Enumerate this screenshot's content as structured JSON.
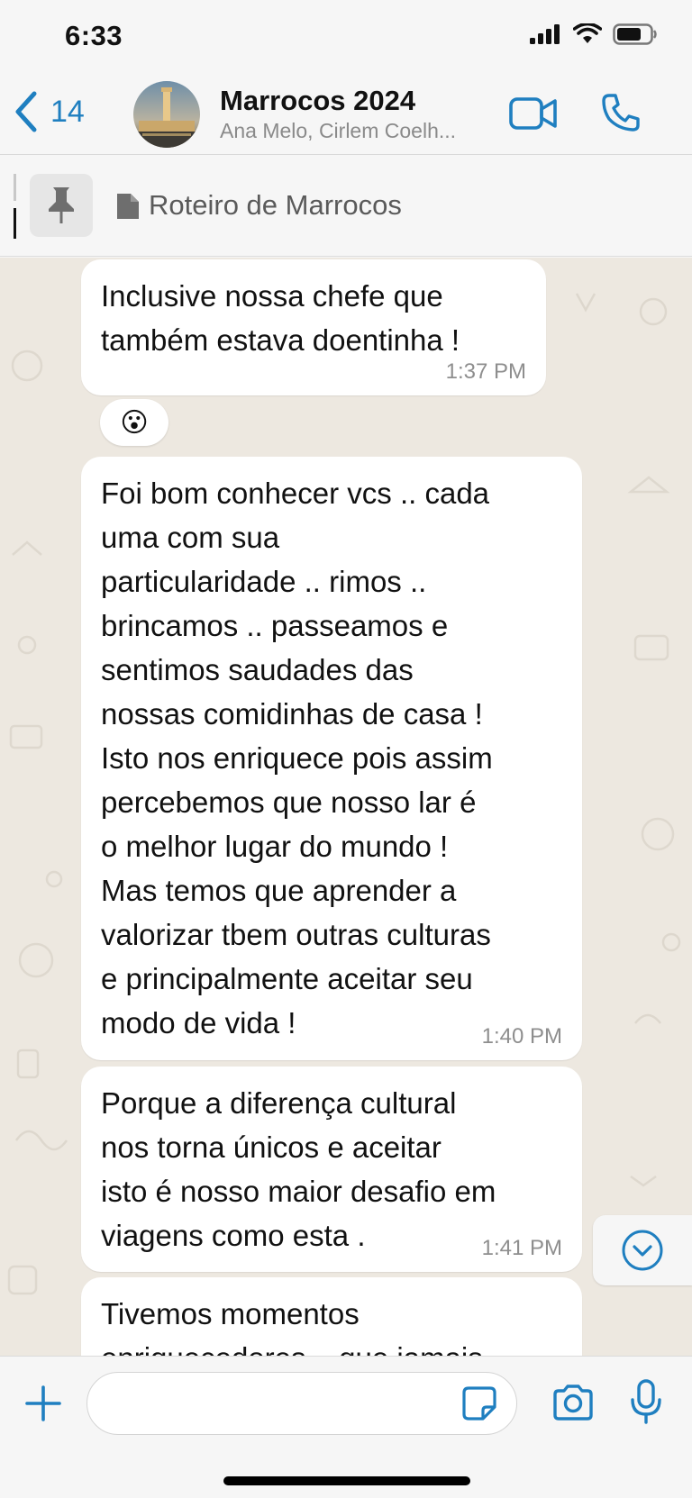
{
  "status_bar": {
    "time": "6:33"
  },
  "header": {
    "back_count": "14",
    "title": "Marrocos 2024",
    "subtitle": "Ana Melo, Cirlem Coelh...",
    "icons": {
      "back": "chevron-left-icon",
      "video": "video-camera-icon",
      "call": "phone-icon"
    }
  },
  "pinned": {
    "label": "Roteiro de Marrocos",
    "icon": "pin-icon"
  },
  "messages": [
    {
      "text": "Inclusive nossa chefe que\ntambém estava doentinha !",
      "time": "1:37 PM",
      "reaction": "😮"
    },
    {
      "text": "Foi bom conhecer vcs .. cada\numa com sua\nparticularidade .. rimos ..\nbrincamos .. passeamos e\nsentimos saudades das\nnossas comidinhas de casa !\nIsto nos enriquece pois assim\npercebemos que nosso lar é\no melhor lugar do mundo !\nMas temos que aprender a\nvalorizar tbem outras culturas\ne principalmente aceitar seu\nmodo de vida !",
      "time": "1:40 PM"
    },
    {
      "text": "Porque a diferença cultural\nnos torna únicos e aceitar\nisto é nosso maior desafio em\nviagens como esta .",
      "time": "1:41 PM"
    },
    {
      "text": "Tivemos momentos\nenriquecedores .. que jamais"
    }
  ],
  "composer": {
    "placeholder": "",
    "value": ""
  },
  "colors": {
    "accent": "#1f7fc0",
    "chat_bg": "#ede8e0",
    "bubble": "#ffffff"
  }
}
